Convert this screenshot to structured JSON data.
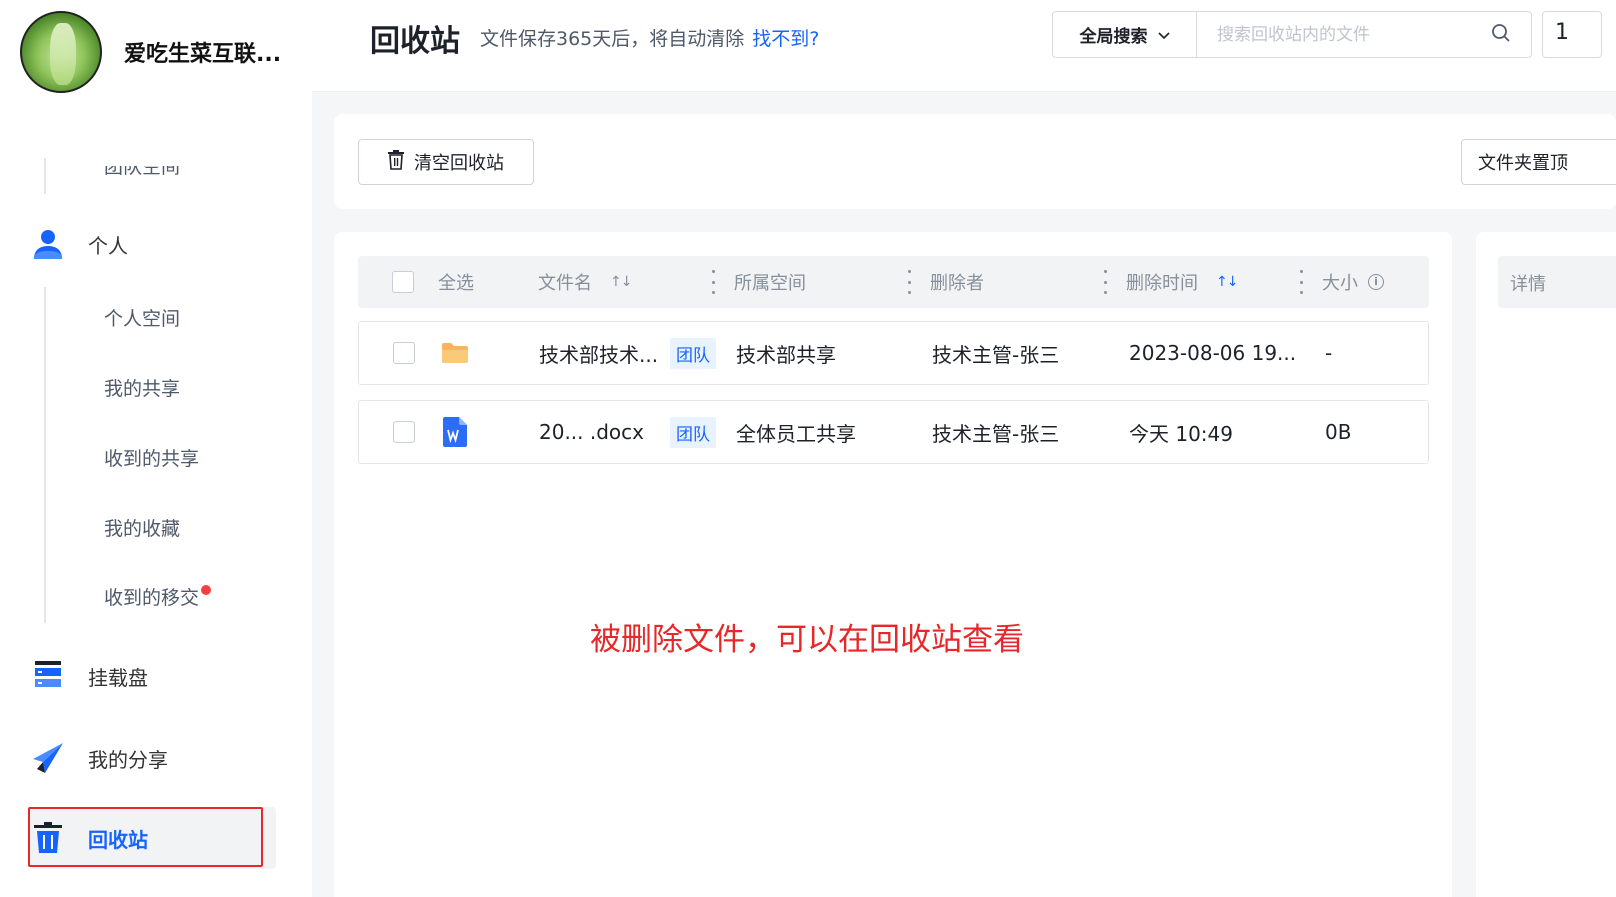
{
  "brand": {
    "name": "爱吃生菜互联..."
  },
  "sidebar": {
    "team_space_cut": "团队空间",
    "personal": {
      "label": "个人",
      "items": [
        "个人空间",
        "我的共享",
        "收到的共享",
        "我的收藏",
        "收到的移交"
      ]
    },
    "mount": "挂载盘",
    "share": "我的分享",
    "recycle": "回收站"
  },
  "header": {
    "title": "回收站",
    "desc": "文件保存365天后，将自动清除",
    "link": "找不到?",
    "scope": "全局搜索",
    "search_placeholder": "搜索回收站内的文件",
    "extra": "1"
  },
  "toolbar": {
    "empty_button": "清空回收站",
    "folder_top_button": "文件夹置顶"
  },
  "table": {
    "columns": {
      "select_all": "全选",
      "name": "文件名",
      "space": "所属空间",
      "deleter": "删除者",
      "time": "删除时间",
      "size": "大小"
    },
    "rows": [
      {
        "name": "技术部技术...",
        "tag": "团队",
        "space": "技术部共享",
        "deleter": "技术主管-张三",
        "time": "2023-08-06 19...",
        "size": "-"
      },
      {
        "name": "20... .docx",
        "tag": "团队",
        "space": "全体员工共享",
        "deleter": "技术主管-张三",
        "time": "今天 10:49",
        "size": "0B"
      }
    ]
  },
  "detail": {
    "title": "详情"
  },
  "annotation": "被删除文件，可以在回收站查看",
  "colors": {
    "accent": "#1664ff",
    "annotation": "#e62828",
    "folder": "#f7b55e",
    "word": "#2b6df5"
  }
}
